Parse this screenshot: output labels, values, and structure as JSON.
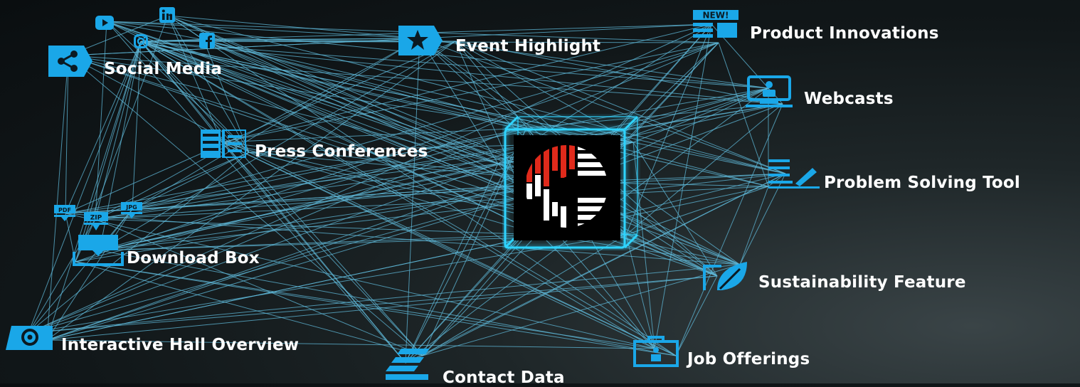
{
  "colors": {
    "accent": "#1aa7e8",
    "line": "#5fb8d8",
    "label": "#ffffff",
    "glow": "#2fd4ff",
    "brand_red": "#e02a1b"
  },
  "center": {
    "name": "brand-logo"
  },
  "social": {
    "label": "Social Media",
    "icons": [
      "youtube-icon",
      "linkedin-icon",
      "instagram-icon",
      "facebook-icon"
    ]
  },
  "event": {
    "label": "Event Highlight"
  },
  "product": {
    "label": "Product Innovations",
    "badge": "NEW!"
  },
  "webcasts": {
    "label": "Webcasts"
  },
  "press": {
    "label": "Press Conferences"
  },
  "problem": {
    "label": "Problem Solving Tool"
  },
  "download": {
    "label": "Download Box",
    "files": [
      "PDF",
      "ZIP",
      "JPG"
    ]
  },
  "sustain": {
    "label": "Sustainability Feature"
  },
  "hall": {
    "label": "Interactive Hall Overview"
  },
  "contact": {
    "label": "Contact Data"
  },
  "jobs": {
    "label": "Job Offerings"
  }
}
